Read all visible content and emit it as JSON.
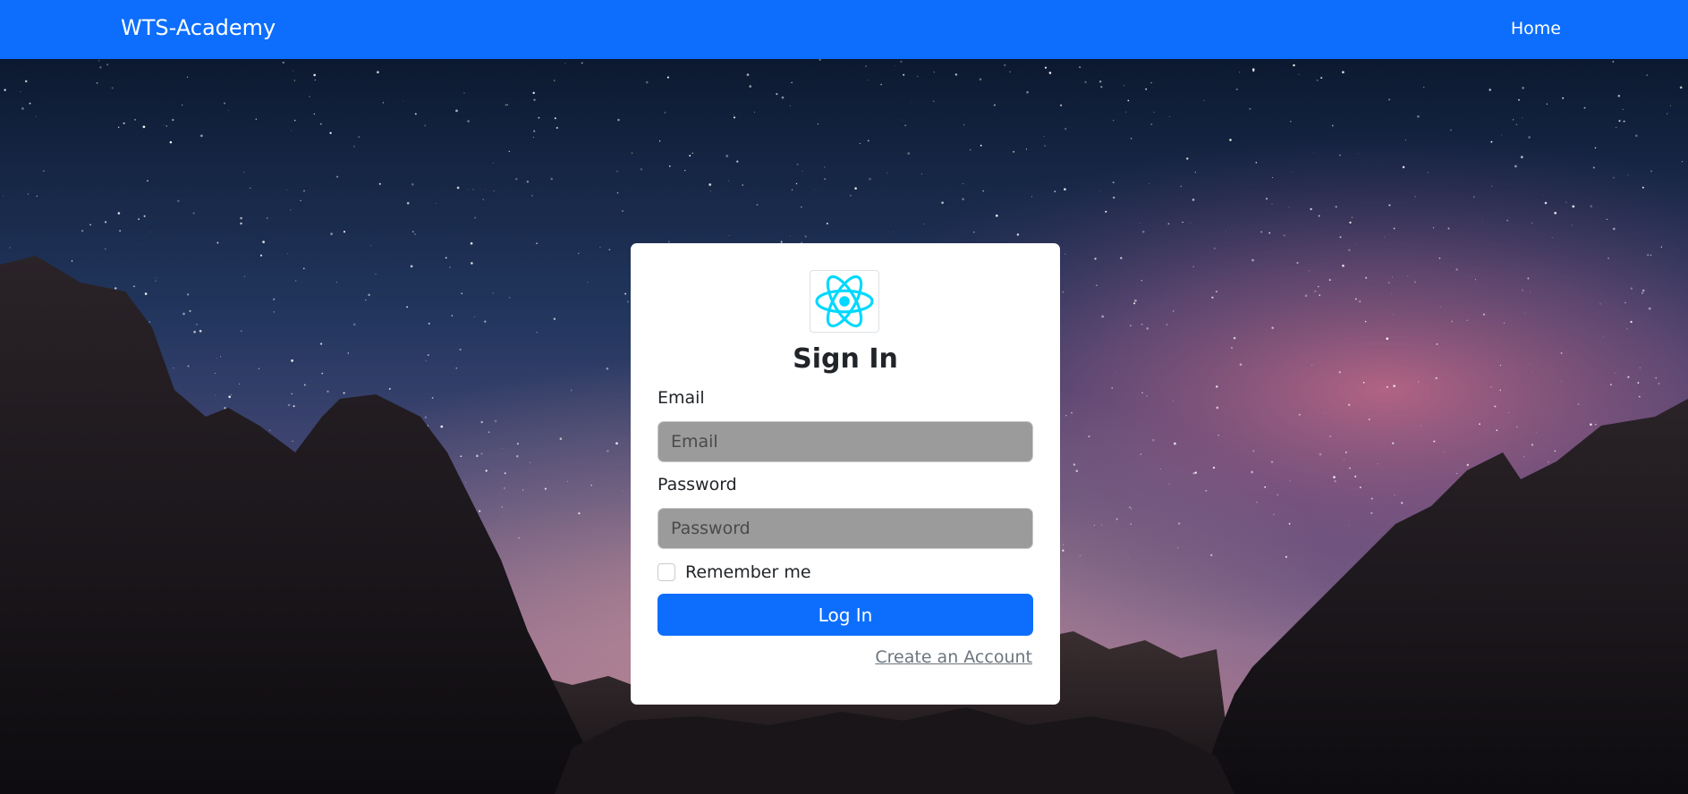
{
  "navbar": {
    "brand": "WTS-Academy",
    "home_label": "Home",
    "color": "#0d6efd"
  },
  "background": {
    "description_icon": "night-sky-mountains-image"
  },
  "login": {
    "logo_icon": "react-logo-icon",
    "logo_color": "#00d8ff",
    "title": "Sign In",
    "email_label": "Email",
    "email_placeholder": "Email",
    "email_value": "",
    "password_label": "Password",
    "password_placeholder": "Password",
    "password_value": "",
    "remember_label": "Remember me",
    "remember_checked": false,
    "submit_label": "Log In",
    "create_account_label": "Create an Account",
    "accent_color": "#0d6efd"
  }
}
